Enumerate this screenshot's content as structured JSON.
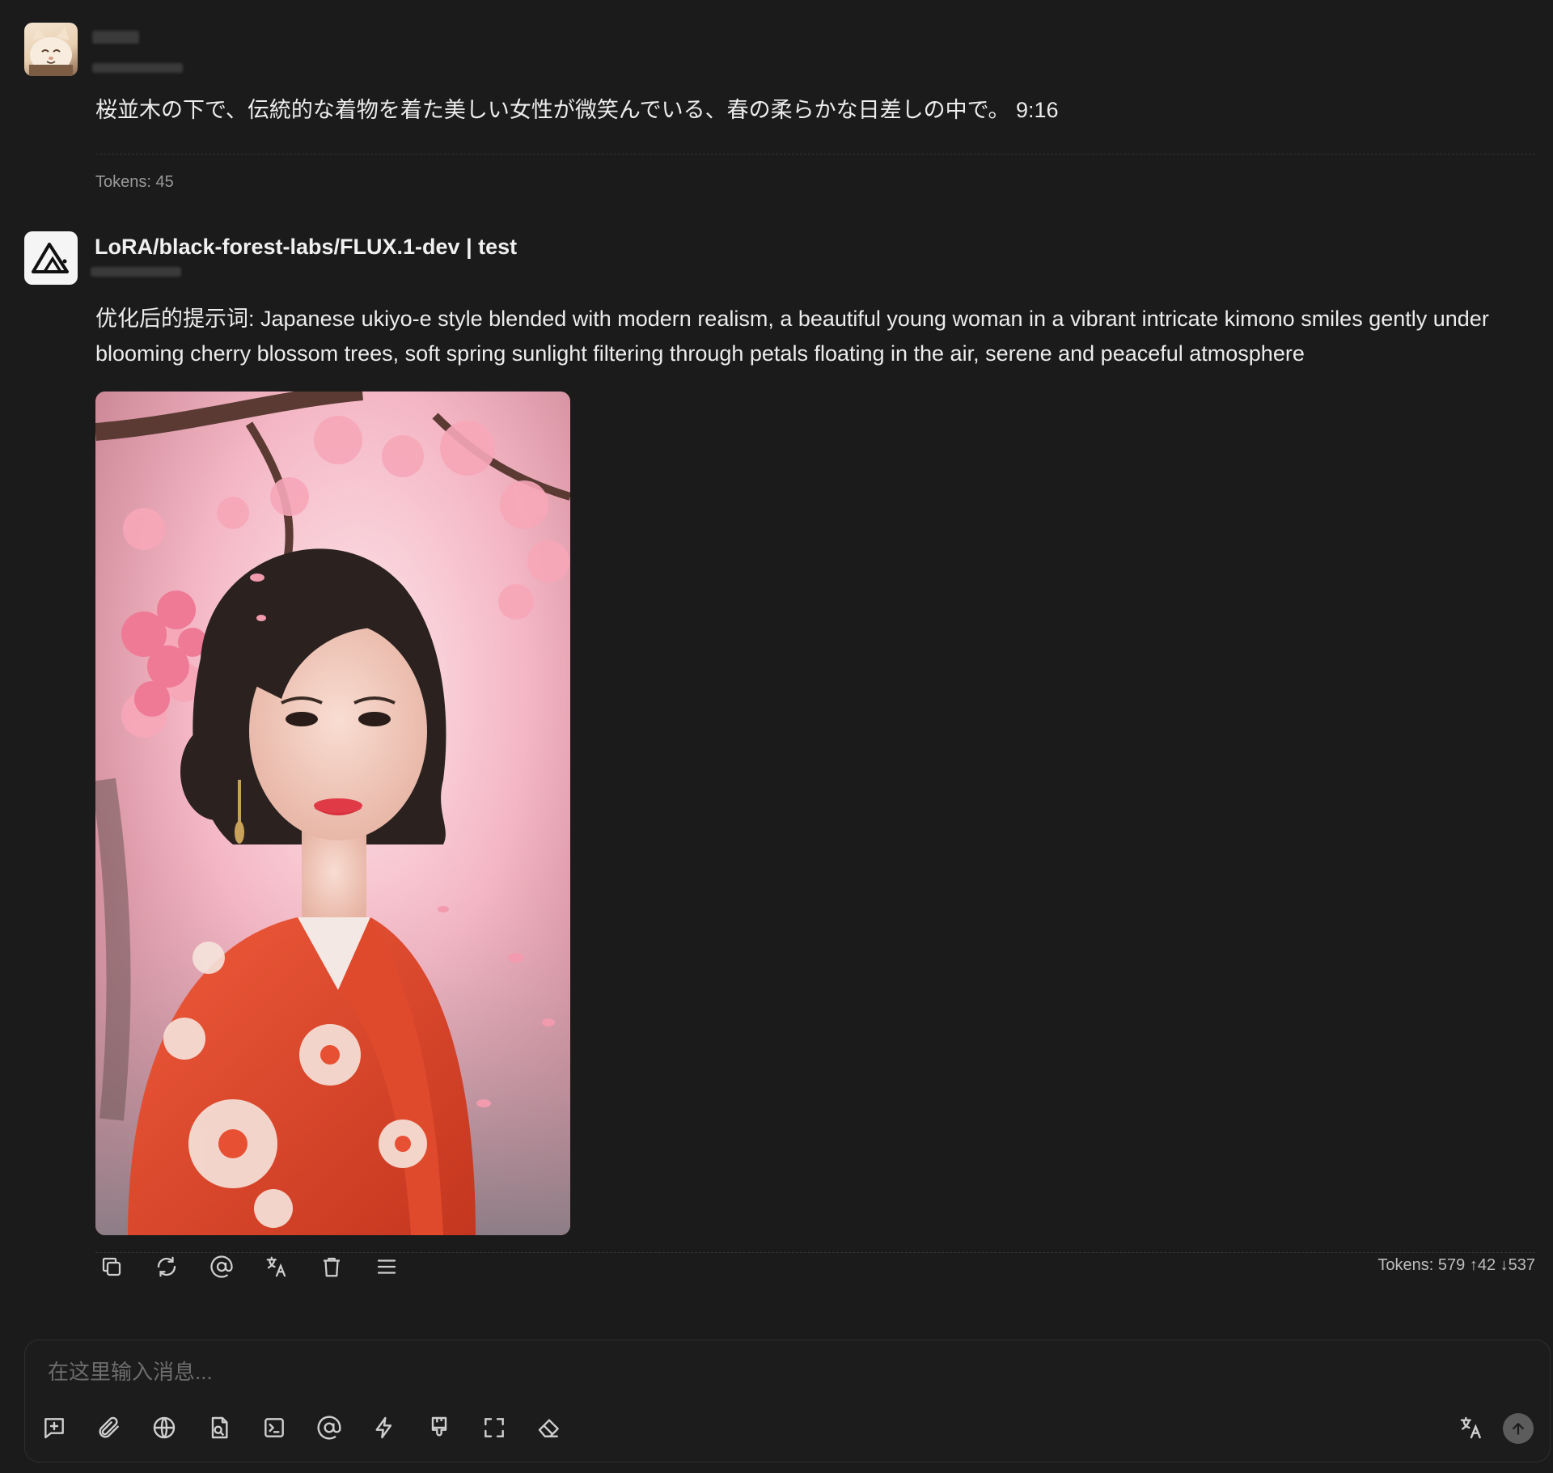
{
  "user_message": {
    "text": "桜並木の下で、伝統的な着物を着た美しい女性が微笑んでいる、春の柔らかな日差しの中で。 9:16",
    "tokens": "Tokens: 45"
  },
  "assistant_message": {
    "model": "LoRA/black-forest-labs/FLUX.1-dev | test",
    "text": "优化后的提示词: Japanese ukiyo-e style blended with modern realism, a beautiful young woman in a vibrant intricate kimono smiles gently under blooming cherry blossom trees, soft spring sunlight filtering through petals floating in the air, serene and peaceful atmosphere",
    "tokens": "Tokens: 579 ↑42 ↓537"
  },
  "message_actions": [
    "copy-icon",
    "regenerate-icon",
    "mention-icon",
    "translate-icon",
    "delete-icon",
    "menu-icon"
  ],
  "input": {
    "placeholder": "在这里输入消息..."
  },
  "input_tools": [
    "new-topic-icon",
    "attach-icon",
    "web-search-icon",
    "knowledge-icon",
    "terminal-icon",
    "mention-icon",
    "quick-phrase-icon",
    "brush-icon",
    "fullscreen-icon",
    "eraser-icon"
  ],
  "colors": {
    "background": "#1b1b1b",
    "text": "#ececec",
    "muted": "#9a9a9a",
    "send_button": "#5c5c5c"
  }
}
